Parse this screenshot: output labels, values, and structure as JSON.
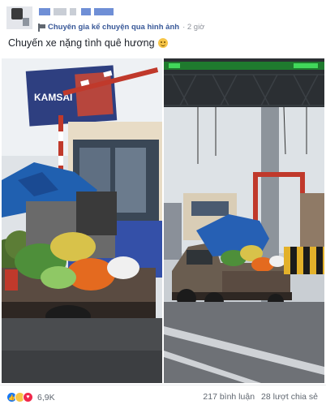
{
  "post": {
    "group_name": "Chuyên gia kể chuyện qua hình ảnh",
    "time": "· 2 giờ",
    "caption": "Chuyến xe nặng tình quê hương",
    "caption_emoji": "smiling-face-icon"
  },
  "photos": {
    "left": {
      "sign_text": "KAMSAI"
    },
    "right": {}
  },
  "footer": {
    "reaction_count": "6,9K",
    "comments": "217 bình luận",
    "shares": "28 lượt chia sẻ"
  },
  "colors": {
    "group_link": "#385898",
    "like": "#1877f2",
    "haha": "#f7c547",
    "love": "#f0284a"
  }
}
